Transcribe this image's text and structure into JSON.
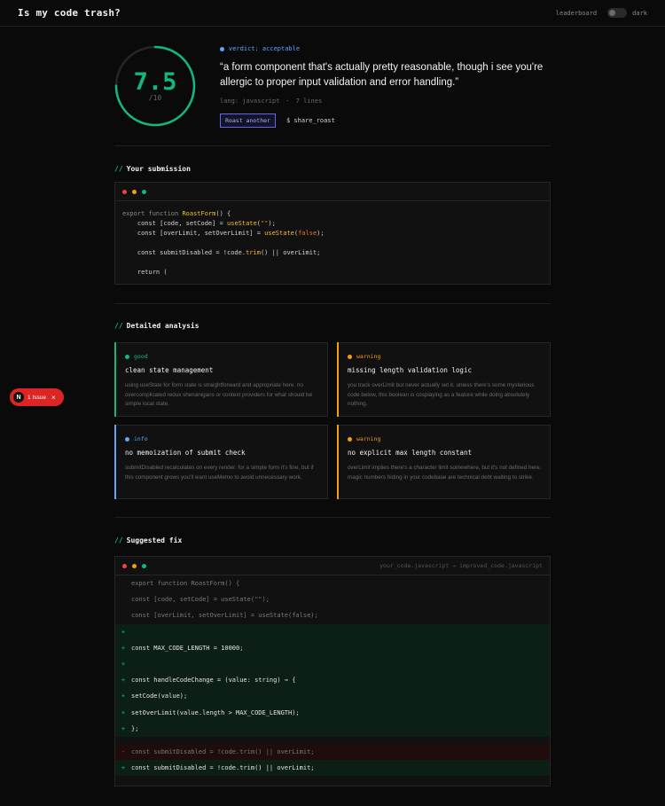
{
  "header": {
    "brand": "Is my code trash?",
    "leaderboard_link": "leaderboard",
    "theme_label": "dark"
  },
  "result": {
    "score": "7.5",
    "score_denominator": "/10",
    "score_value": 7.5,
    "score_max": 10,
    "verdict": "verdict: acceptable",
    "quote": "“a form component that's actually pretty reasonable, though i see you're allergic to proper input validation and error handling.”",
    "lang": "lang: javascript",
    "lines": "7 lines",
    "roast_button": "Roast another",
    "share_button": "$ share_roast"
  },
  "submission": {
    "title": "Your submission",
    "code": [
      {
        "parts": [
          {
            "t": "export function ",
            "c": "kw"
          },
          {
            "t": "RoastForm",
            "c": "fn"
          },
          {
            "t": "() {",
            "c": ""
          }
        ]
      },
      {
        "parts": [
          {
            "t": "    const [code, setCode] = ",
            "c": ""
          },
          {
            "t": "useState",
            "c": "fn"
          },
          {
            "t": "(",
            "c": ""
          },
          {
            "t": "\"\"",
            "c": "str"
          },
          {
            "t": ");",
            "c": ""
          }
        ]
      },
      {
        "parts": [
          {
            "t": "    const [overLimit, setOverLimit] = ",
            "c": ""
          },
          {
            "t": "useState",
            "c": "fn"
          },
          {
            "t": "(",
            "c": ""
          },
          {
            "t": "false",
            "c": "str"
          },
          {
            "t": ");",
            "c": ""
          }
        ]
      },
      {
        "parts": [
          {
            "t": "",
            "c": ""
          }
        ]
      },
      {
        "parts": [
          {
            "t": "    const submitDisabled = !code.",
            "c": ""
          },
          {
            "t": "trim",
            "c": "fn"
          },
          {
            "t": "() || overLimit;",
            "c": ""
          }
        ]
      },
      {
        "parts": [
          {
            "t": "",
            "c": ""
          }
        ]
      },
      {
        "parts": [
          {
            "t": "    return (",
            "c": ""
          }
        ]
      }
    ]
  },
  "analysis": {
    "title": "Detailed analysis",
    "cards": [
      {
        "tag": "good",
        "color": "#10b981",
        "title": "clean state management",
        "desc": "using useState for form state is straightforward and appropriate here. no overcomplicated redux shenanigans or context providers for what should be simple local state."
      },
      {
        "tag": "warning",
        "color": "#f59e0b",
        "title": "missing length validation logic",
        "desc": "you track overLimit but never actually set it. unless there's some mysterious code below, this boolean is cosplaying as a feature while doing absolutely nothing."
      },
      {
        "tag": "info",
        "color": "#60a5fa",
        "title": "no memoization of submit check",
        "desc": "submitDisabled recalculates on every render. for a simple form it's fine, but if this component grows you'll want useMemo to avoid unnecessary work."
      },
      {
        "tag": "warning",
        "color": "#f59e0b",
        "title": "no explicit max length constant",
        "desc": "overLimit implies there's a character limit somewhere, but it's not defined here. magic numbers hiding in your codebase are technical debt waiting to strike."
      }
    ]
  },
  "fix": {
    "title": "Suggested fix",
    "file_label": "your_code.javascript → improved_code.javascript",
    "rows": [
      {
        "type": "ctx",
        "sign": "",
        "text": "export function RoastForm() {"
      },
      {
        "type": "ctx",
        "sign": "",
        "text": "const [code, setCode] = useState(\"\");"
      },
      {
        "type": "ctx",
        "sign": "",
        "text": "const [overLimit, setOverLimit] = useState(false);"
      },
      {
        "type": "add",
        "sign": "+",
        "text": ""
      },
      {
        "type": "add",
        "sign": "+",
        "text": "const MAX_CODE_LENGTH = 10000;"
      },
      {
        "type": "add",
        "sign": "+",
        "text": ""
      },
      {
        "type": "add",
        "sign": "+",
        "text": "const handleCodeChange = (value: string) ⇒ {"
      },
      {
        "type": "add",
        "sign": "+",
        "text": "setCode(value);"
      },
      {
        "type": "add",
        "sign": "+",
        "text": "setOverLimit(value.length > MAX_CODE_LENGTH);"
      },
      {
        "type": "add",
        "sign": "+",
        "text": "};"
      },
      {
        "type": "gap",
        "sign": "",
        "text": ""
      },
      {
        "type": "del",
        "sign": "-",
        "text": "const submitDisabled = !code.trim() || overLimit;"
      },
      {
        "type": "add",
        "sign": "+",
        "text": "const submitDisabled = !code.trim() || overLimit;"
      }
    ]
  },
  "dev_badge": {
    "logo": "N",
    "text": "1 Issue",
    "close": "×"
  },
  "colors": {
    "accent_green": "#10b981",
    "verdict_blue": "#60a5fa",
    "button_indigo": "#6366f1",
    "issue_red": "#dc2626"
  }
}
